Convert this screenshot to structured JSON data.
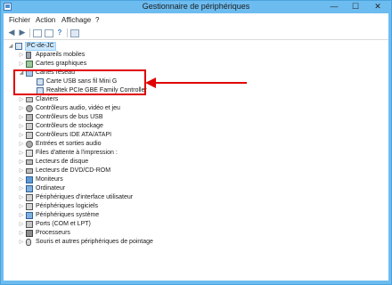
{
  "window": {
    "title": "Gestionnaire de périphériques"
  },
  "controls": {
    "minimize": "—",
    "maximize": "☐",
    "close": "✕"
  },
  "menu": [
    "Fichier",
    "Action",
    "Affichage",
    "?"
  ],
  "tree": {
    "root": "PC-de-JC",
    "categories": [
      {
        "label": "Appareils mobiles"
      },
      {
        "label": "Cartes graphiques"
      },
      {
        "label": "Cartes réseau",
        "expanded": true,
        "children": [
          "Carte USB sans fil Mini G",
          "Realtek PCIe GBE Family Controller"
        ]
      },
      {
        "label": "Claviers"
      },
      {
        "label": "Contrôleurs audio, vidéo et jeu"
      },
      {
        "label": "Contrôleurs de bus USB"
      },
      {
        "label": "Contrôleurs de stockage"
      },
      {
        "label": "Contrôleurs IDE ATA/ATAPI"
      },
      {
        "label": "Entrées et sorties audio"
      },
      {
        "label": "Files d'attente à l'impression :"
      },
      {
        "label": "Lecteurs de disque"
      },
      {
        "label": "Lecteurs de DVD/CD-ROM"
      },
      {
        "label": "Moniteurs"
      },
      {
        "label": "Ordinateur"
      },
      {
        "label": "Périphériques d'interface utilisateur"
      },
      {
        "label": "Périphériques logiciels"
      },
      {
        "label": "Périphériques système"
      },
      {
        "label": "Ports (COM et LPT)"
      },
      {
        "label": "Processeurs"
      },
      {
        "label": "Souris et autres périphériques de pointage"
      }
    ]
  },
  "colors": {
    "frame": "#6dbcf0",
    "highlight": "#e00000",
    "selection": "#cce8ff"
  }
}
